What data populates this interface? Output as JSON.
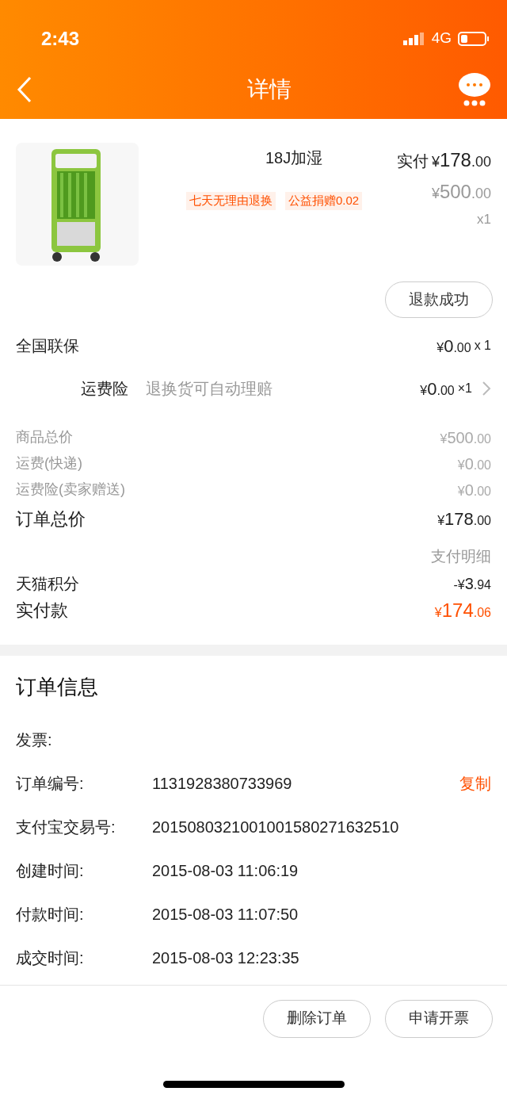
{
  "status_bar": {
    "time": "2:43",
    "network": "4G"
  },
  "nav": {
    "title": "详情"
  },
  "product": {
    "kind": "picture",
    "name": "18J加湿",
    "paid_label": "实付",
    "paid": {
      "currency": "¥",
      "integer": "178",
      "decimals": ".00"
    },
    "original": {
      "currency": "¥",
      "integer": "500",
      "decimals": ".00"
    },
    "quantity": "x1",
    "tags": [
      "七天无理由退换",
      "公益捐赠0.02"
    ],
    "status_button": "退款成功"
  },
  "services": [
    {
      "kind": "plain",
      "label": "全国联保",
      "price": {
        "currency": "¥",
        "integer": "0",
        "decimals": ".00"
      },
      "quantity": "x 1"
    },
    {
      "kind": "link",
      "label": "运费险",
      "note": "退换货可自动理赔",
      "price": {
        "currency": "¥",
        "integer": "0",
        "decimals": ".00"
      },
      "quantity": "×1"
    }
  ],
  "summary": [
    {
      "kind": "minor",
      "label": "商品总价",
      "price": {
        "currency": "¥",
        "integer": "500",
        "decimals": ".00"
      }
    },
    {
      "kind": "minor",
      "label": "运费(快递)",
      "price": {
        "currency": "¥",
        "integer": "0",
        "decimals": ".00"
      }
    },
    {
      "kind": "minor",
      "label": "运费险(卖家赠送)",
      "price": {
        "currency": "¥",
        "integer": "0",
        "decimals": ".00"
      }
    },
    {
      "kind": "major",
      "label": "订单总价",
      "price": {
        "currency": "¥",
        "integer": "178",
        "decimals": ".00"
      }
    }
  ],
  "payment": {
    "title": "支付明细",
    "rows": [
      {
        "kind": "discount",
        "label": "天猫积分",
        "price": {
          "currency": "-¥",
          "integer": "3",
          "decimals": ".94"
        }
      },
      {
        "kind": "total",
        "label": "实付款",
        "price": {
          "currency": "¥",
          "integer": "174",
          "decimals": ".06"
        }
      }
    ]
  },
  "order_info": {
    "title": "订单信息",
    "rows": [
      {
        "label": "发票:"
      },
      {
        "label": "订单编号:",
        "value": "1131928380733969",
        "action": "复制"
      },
      {
        "label": "支付宝交易号:",
        "value": "2015080321001001580271632510"
      },
      {
        "label": "创建时间:",
        "value": "2015-08-03 11:06:19"
      },
      {
        "label": "付款时间:",
        "value": "2015-08-03 11:07:50"
      },
      {
        "label": "成交时间:",
        "value": "2015-08-03 12:23:35"
      }
    ]
  },
  "actions": [
    "删除订单",
    "申请开票"
  ]
}
